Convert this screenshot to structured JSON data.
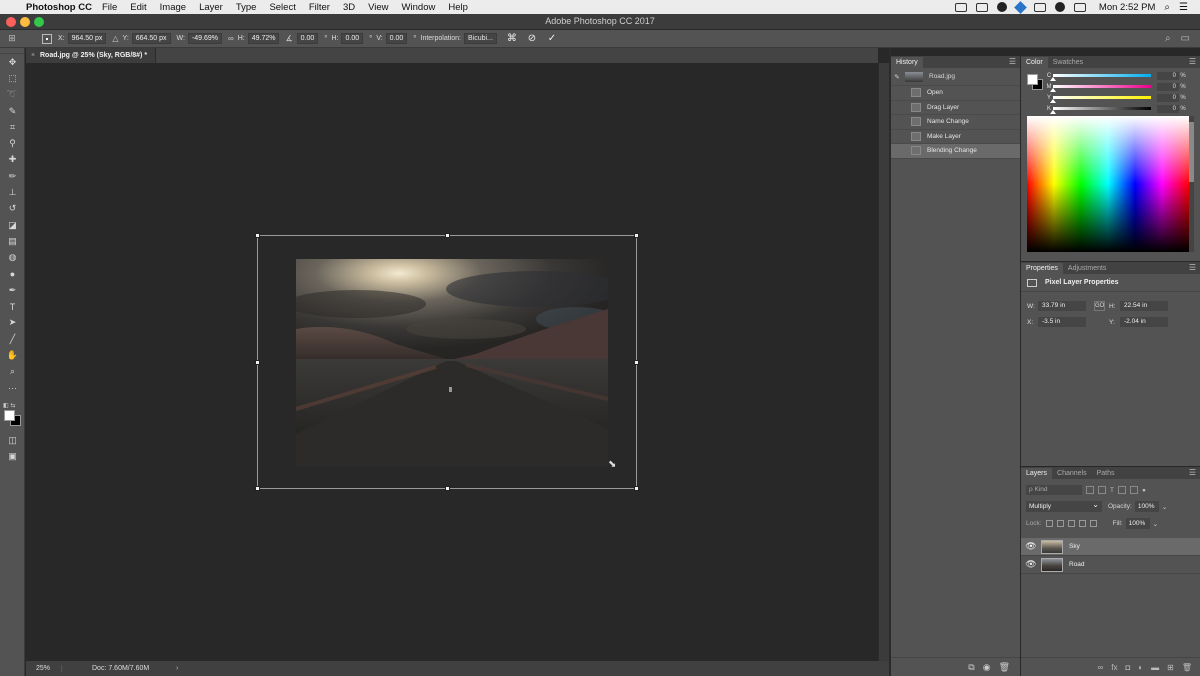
{
  "menubar": {
    "apple": "",
    "app": "Photoshop CC",
    "items": [
      "File",
      "Edit",
      "Image",
      "Layer",
      "Type",
      "Select",
      "Filter",
      "3D",
      "View",
      "Window",
      "Help"
    ],
    "clock": "Mon 2:52 PM"
  },
  "window": {
    "title": "Adobe Photoshop CC 2017",
    "lights": [
      "#fc605b",
      "#fdbc40",
      "#34c84a"
    ]
  },
  "options": {
    "x_label": "X:",
    "x": "964.50 px",
    "y_label": "Y:",
    "y": "664.50 px",
    "w_label": "W:",
    "w": "-49.69%",
    "h_label": "H:",
    "h": "49.72%",
    "angle": "0.00",
    "angle_unit": "°",
    "hskew_label": "H:",
    "hskew": "0.00",
    "hskew_unit": "°",
    "vskew_label": "V:",
    "vskew": "0.00",
    "vskew_unit": "°",
    "interp_label": "Interpolation:",
    "interp": "Bicubi..."
  },
  "doc": {
    "tab": "Road.jpg @ 25% (Sky, RGB/8#) *",
    "tab_close": "×",
    "zoom": "25%",
    "info": "Doc: 7.60M/7.60M",
    "info_arrow": "›"
  },
  "history": {
    "tab": "History",
    "snapshot": "Road.jpg",
    "items": [
      "Open",
      "Drag Layer",
      "Name Change",
      "Make Layer",
      "Blending Change"
    ],
    "active_index": 4
  },
  "color": {
    "tabs": [
      "Color",
      "Swatches"
    ],
    "channels": [
      {
        "label": "C",
        "value": "0",
        "unit": "%",
        "gradient": "linear-gradient(to right,#ffffff,#00aeef)"
      },
      {
        "label": "M",
        "value": "0",
        "unit": "%",
        "gradient": "linear-gradient(to right,#ffffff,#ec008c)"
      },
      {
        "label": "Y",
        "value": "0",
        "unit": "%",
        "gradient": "linear-gradient(to right,#ffffff,#fff200)"
      },
      {
        "label": "K",
        "value": "0",
        "unit": "%",
        "gradient": "linear-gradient(to right,#ffffff,#000000)"
      }
    ]
  },
  "properties": {
    "tabs": [
      "Properties",
      "Adjustments"
    ],
    "title": "Pixel Layer Properties",
    "w_label": "W:",
    "w": "33.79 in",
    "h_label": "H:",
    "h": "22.54 in",
    "x_label": "X:",
    "x": "-3.5 in",
    "y_label": "Y:",
    "y": "-2.04 in",
    "link_label": "GO"
  },
  "layers": {
    "tabs": [
      "Layers",
      "Channels",
      "Paths"
    ],
    "kind": "ρ Kind",
    "blend_mode": "Multiply",
    "opacity_label": "Opacity:",
    "opacity": "100%",
    "lock_label": "Lock:",
    "fill_label": "Fill:",
    "fill": "100%",
    "items": [
      {
        "name": "Sky",
        "visible": true,
        "active": true
      },
      {
        "name": "Road",
        "visible": true,
        "active": false
      }
    ]
  }
}
